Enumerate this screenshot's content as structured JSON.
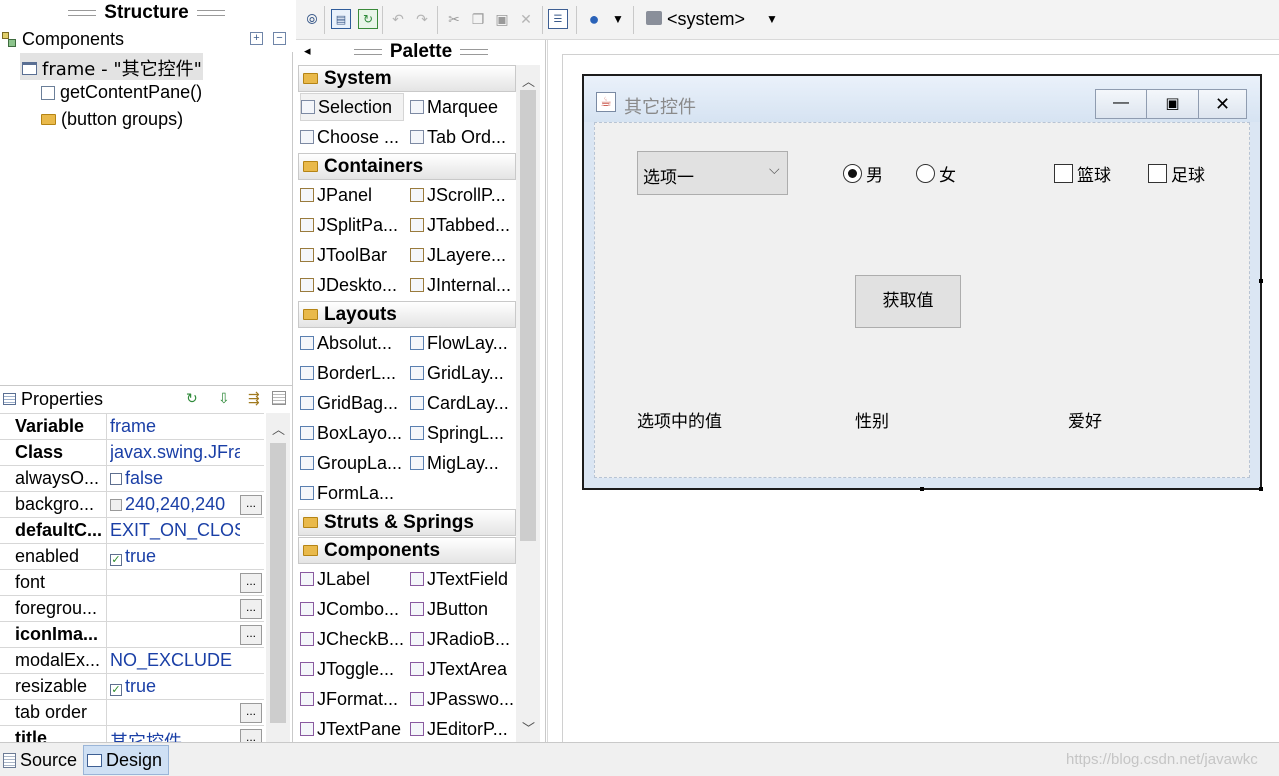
{
  "structure": {
    "title": "Structure",
    "tree": [
      {
        "label": "Components",
        "icon": "components-icon"
      },
      {
        "label": "frame - \"其它控件\"",
        "icon": "frame-icon"
      },
      {
        "label": "getContentPane()",
        "icon": "pane-icon"
      },
      {
        "label": "(button groups)",
        "icon": "folder-icon"
      }
    ]
  },
  "properties": {
    "title": "Properties",
    "rows": [
      {
        "name": "Variable",
        "value": "frame",
        "bold": true
      },
      {
        "name": "Class",
        "value": "javax.swing.JFra...",
        "bold": true
      },
      {
        "name": "alwaysO...",
        "value": "false",
        "check": false
      },
      {
        "name": "backgro...",
        "value": "240,240,240",
        "swatch": "#f0f0f0",
        "more": true
      },
      {
        "name": "defaultC...",
        "value": "EXIT_ON_CLOSE",
        "bold": true
      },
      {
        "name": "enabled",
        "value": "true",
        "check": true
      },
      {
        "name": "font",
        "value": "",
        "more": true
      },
      {
        "name": "foregrou...",
        "value": "",
        "more": true
      },
      {
        "name": "iconIma...",
        "value": "",
        "bold": true,
        "more": true
      },
      {
        "name": "modalEx...",
        "value": "NO_EXCLUDE"
      },
      {
        "name": "resizable",
        "value": "true",
        "check": true
      },
      {
        "name": "tab order",
        "value": "",
        "more": true
      },
      {
        "name": "title",
        "value": "其它控件",
        "bold": true,
        "more": true
      }
    ]
  },
  "toolbar": {
    "system_label": "<system>"
  },
  "palette": {
    "title": "Palette",
    "categories": [
      {
        "name": "System",
        "items": [
          "Selection",
          "Marquee",
          "Choose ...",
          "Tab Ord..."
        ]
      },
      {
        "name": "Containers",
        "items": [
          "JPanel",
          "JScrollP...",
          "JSplitPa...",
          "JTabbed...",
          "JToolBar",
          "JLayere...",
          "JDeskto...",
          "JInternal..."
        ]
      },
      {
        "name": "Layouts",
        "items": [
          "Absolut...",
          "FlowLay...",
          "BorderL...",
          "GridLay...",
          "GridBag...",
          "CardLay...",
          "BoxLayo...",
          "SpringL...",
          "GroupLa...",
          "MigLay...",
          "FormLa..."
        ]
      },
      {
        "name": "Struts & Springs",
        "items": []
      },
      {
        "name": "Components",
        "items": [
          "JLabel",
          "JTextField",
          "JCombo...",
          "JButton",
          "JCheckB...",
          "JRadioB...",
          "JToggle...",
          "JTextArea",
          "JFormat...",
          "JPasswo...",
          "JTextPane",
          "JEditorP..."
        ]
      }
    ]
  },
  "design_frame": {
    "title": "其它控件",
    "combo_value": "选项一",
    "radio_male": "男",
    "radio_female": "女",
    "check_basketball": "篮球",
    "check_football": "足球",
    "button_label": "获取值",
    "label_selected": "选项中的值",
    "label_gender": "性别",
    "label_hobby": "爱好"
  },
  "bottom_tabs": [
    "Source",
    "Design"
  ],
  "watermark": "https://blog.csdn.net/javawkc"
}
